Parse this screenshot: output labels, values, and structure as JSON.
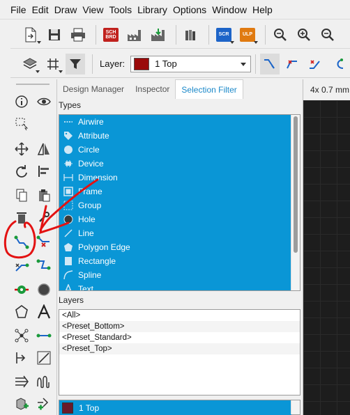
{
  "menu": [
    "File",
    "Edit",
    "Draw",
    "View",
    "Tools",
    "Library",
    "Options",
    "Window",
    "Help"
  ],
  "toolbar1": {
    "badges": {
      "sch_brd": "SCH BRD",
      "scr": "SCR",
      "ulp": "ULP"
    }
  },
  "toolbar2": {
    "layer_label": "Layer:",
    "layer_value": "1 Top",
    "layer_color": "#9a0a0a"
  },
  "panel": {
    "tabs": [
      "Design Manager",
      "Inspector",
      "Selection Filter"
    ],
    "active_tab": "Selection Filter",
    "types_label": "Types",
    "types": [
      "Airwire",
      "Attribute",
      "Circle",
      "Device",
      "Dimension",
      "Frame",
      "Group",
      "Hole",
      "Line",
      "Polygon Edge",
      "Rectangle",
      "Spline",
      "Text"
    ],
    "layers_label": "Layers",
    "layers": [
      "<All>",
      "<Preset_Bottom>",
      "<Preset_Standard>",
      "<Preset_Top>"
    ],
    "selected_layer": "1 Top",
    "selected_layer_color": "#6a1a2a"
  },
  "canvas": {
    "header": "4x 0.7 mm"
  },
  "colors": {
    "selection_blue": "#0a96d6",
    "accent_tab": "#1a88c9",
    "annotation_red": "#e31212"
  }
}
